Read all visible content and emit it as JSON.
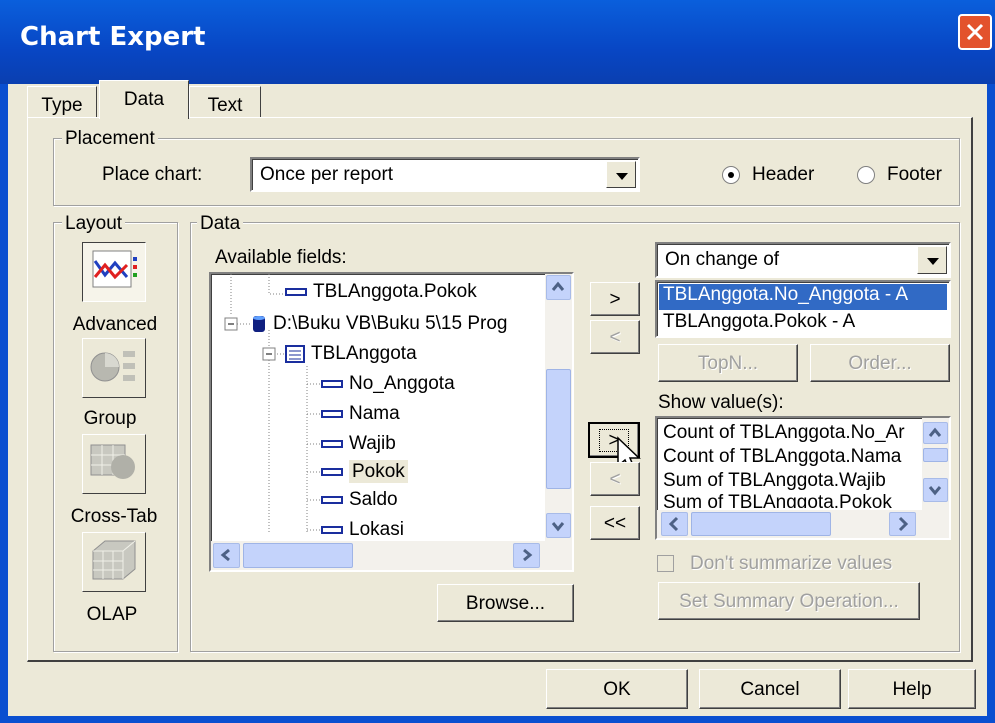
{
  "window": {
    "title": "Chart Expert"
  },
  "tabs": [
    {
      "label": "Type",
      "active": false
    },
    {
      "label": "Data",
      "active": true
    },
    {
      "label": "Text",
      "active": false
    }
  ],
  "placement": {
    "legend": "Placement",
    "place_chart_label": "Place chart:",
    "place_chart_value": "Once per report",
    "header_label": "Header",
    "footer_label": "Footer",
    "selected": "Header"
  },
  "layout": {
    "legend": "Layout",
    "items": [
      {
        "label": "Advanced",
        "icon": "advanced-chart-icon",
        "selected": true
      },
      {
        "label": "Group",
        "icon": "group-chart-icon",
        "selected": false
      },
      {
        "label": "Cross-Tab",
        "icon": "crosstab-chart-icon",
        "selected": false
      },
      {
        "label": "OLAP",
        "icon": "olap-chart-icon",
        "selected": false
      }
    ]
  },
  "data": {
    "legend": "Data",
    "available_fields_label": "Available fields:",
    "tree": [
      {
        "label": "TBLAnggota.Pokok",
        "type": "field"
      },
      {
        "label": "D:\\Buku VB\\Buku 5\\15 Prog",
        "type": "database"
      },
      {
        "label": "TBLAnggota",
        "type": "table"
      },
      {
        "label": "No_Anggota",
        "type": "field"
      },
      {
        "label": "Nama",
        "type": "field"
      },
      {
        "label": "Wajib",
        "type": "field"
      },
      {
        "label": "Pokok",
        "type": "field",
        "selected": true
      },
      {
        "label": "Saldo",
        "type": "field"
      },
      {
        "label": "Lokasi",
        "type": "field"
      }
    ],
    "browse_label": "Browse...",
    "on_change_value": "On change of",
    "on_change_fields": [
      {
        "label": "TBLAnggota.No_Anggota - A",
        "selected": true
      },
      {
        "label": "TBLAnggota.Pokok - A",
        "selected": false
      }
    ],
    "topn_label": "TopN...",
    "order_label": "Order...",
    "show_values_label": "Show value(s):",
    "show_values": [
      "Count of TBLAnggota.No_Ar",
      "Count of TBLAnggota.Nama",
      "Sum of TBLAnggota.Wajib",
      "Sum of TBLAnggota.Pokok"
    ],
    "dont_summarize_label": "Don't summarize values",
    "set_summary_label": "Set Summary Operation...",
    "add_label": ">",
    "remove_label": "<",
    "add_value_label": ">",
    "remove_value_label": "<",
    "remove_all_label": "<<"
  },
  "footer": {
    "ok_label": "OK",
    "cancel_label": "Cancel",
    "help_label": "Help"
  }
}
